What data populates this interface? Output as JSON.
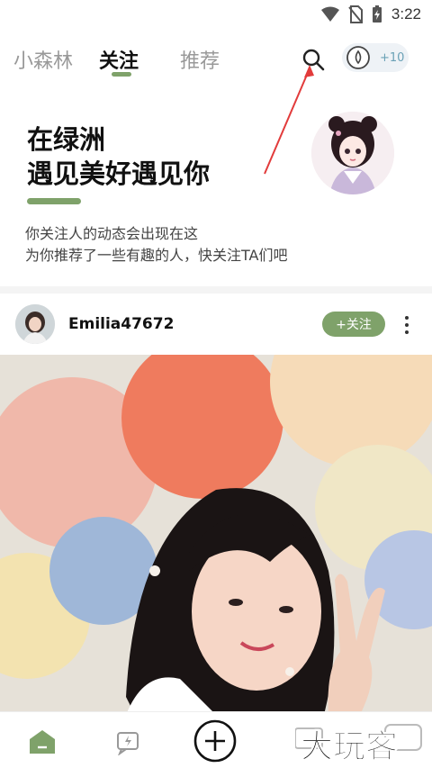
{
  "status": {
    "time": "3:22"
  },
  "nav": {
    "tabs": [
      {
        "label": "小森林"
      },
      {
        "label": "关注"
      },
      {
        "label": "推荐"
      }
    ],
    "water_count": "+10"
  },
  "hero": {
    "title_line1": "在绿洲",
    "title_line2": "遇见美好遇见你",
    "subtitle_line1": "你关注人的动态会出现在这",
    "subtitle_line2": "为你推荐了一些有趣的人，快关注TA们吧"
  },
  "post": {
    "username": "Emilia47672",
    "follow_label": "+关注"
  },
  "watermark_text": "大玩客",
  "colors": {
    "accent": "#7fa26a",
    "annotation": "#e23b3b"
  }
}
